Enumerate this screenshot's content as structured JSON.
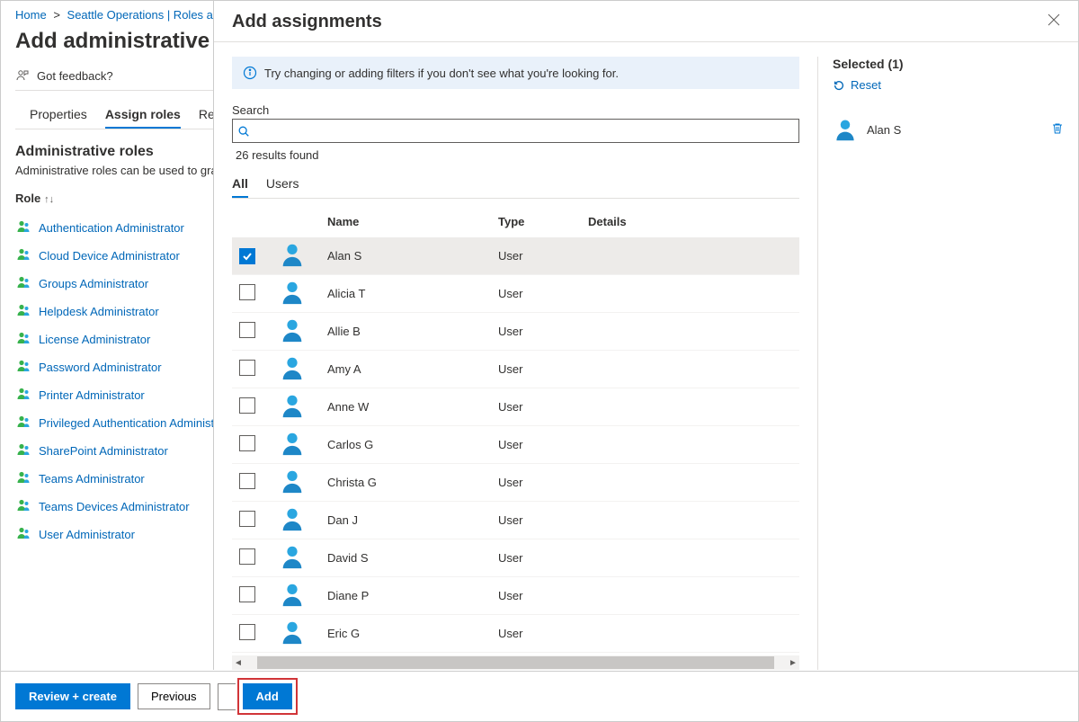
{
  "breadcrumb": {
    "home": "Home",
    "path": "Seattle Operations | Roles and"
  },
  "bg": {
    "title": "Add administrative uni",
    "feedback": "Got feedback?",
    "tabs": {
      "properties": "Properties",
      "assign_roles": "Assign roles",
      "review": "Review"
    },
    "section": {
      "title": "Administrative roles",
      "desc": "Administrative roles can be used to grant"
    },
    "col_role": "Role",
    "roles": [
      "Authentication Administrator",
      "Cloud Device Administrator",
      "Groups Administrator",
      "Helpdesk Administrator",
      "License Administrator",
      "Password Administrator",
      "Printer Administrator",
      "Privileged Authentication Administ",
      "SharePoint Administrator",
      "Teams Administrator",
      "Teams Devices Administrator",
      "User Administrator"
    ]
  },
  "panel": {
    "title": "Add assignments",
    "info": "Try changing or adding filters if you don't see what you're looking for.",
    "search_label": "Search",
    "search_value": "",
    "results_count": "26 results found",
    "tabs": {
      "all": "All",
      "users": "Users"
    },
    "columns": {
      "name": "Name",
      "type": "Type",
      "details": "Details"
    },
    "users": [
      {
        "name": "Alan S",
        "type": "User",
        "selected": true
      },
      {
        "name": "Alicia T",
        "type": "User",
        "selected": false
      },
      {
        "name": "Allie B",
        "type": "User",
        "selected": false
      },
      {
        "name": "Amy A",
        "type": "User",
        "selected": false
      },
      {
        "name": "Anne W",
        "type": "User",
        "selected": false
      },
      {
        "name": "Carlos G",
        "type": "User",
        "selected": false
      },
      {
        "name": "Christa G",
        "type": "User",
        "selected": false
      },
      {
        "name": "Dan J",
        "type": "User",
        "selected": false
      },
      {
        "name": "David S",
        "type": "User",
        "selected": false
      },
      {
        "name": "Diane P",
        "type": "User",
        "selected": false
      },
      {
        "name": "Eric G",
        "type": "User",
        "selected": false
      }
    ],
    "selected": {
      "header": "Selected (1)",
      "reset": "Reset",
      "items": [
        {
          "name": "Alan S"
        }
      ]
    }
  },
  "footer": {
    "review_create": "Review + create",
    "previous": "Previous",
    "add": "Add"
  }
}
